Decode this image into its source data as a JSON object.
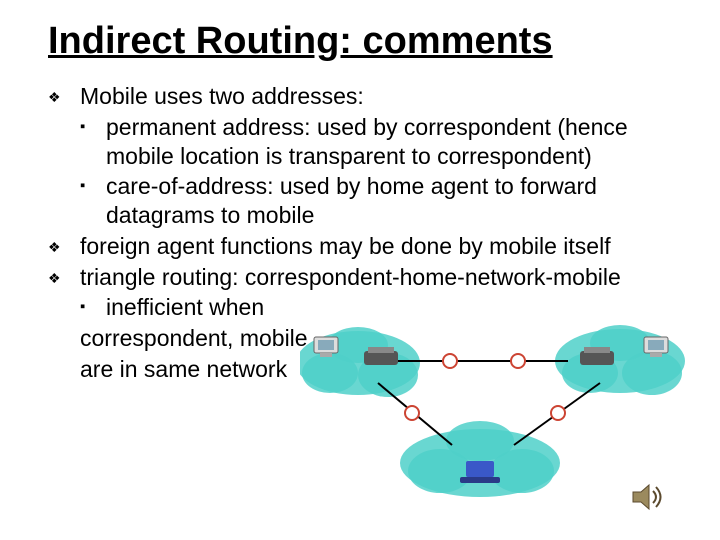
{
  "title": "Indirect Routing: comments",
  "bullets": {
    "b1": "Mobile uses two addresses:",
    "b1a": "permanent address: used by correspondent (hence mobile location is transparent to correspondent)",
    "b1b": "care-of-address: used by home agent to forward datagrams to mobile",
    "b2": "foreign agent functions may be done by mobile itself",
    "b3": "triangle routing: correspondent-home-network-mobile",
    "b3a": "inefficient when",
    "b3cont1": "correspondent, mobile",
    "b3cont2": "are in same network"
  },
  "diagram": {
    "type": "network-clouds",
    "cloud_color": "#4fd0c9",
    "clouds": 3,
    "routers": 3,
    "correspondent_color": "#3a58c8",
    "path_circles": 4
  }
}
